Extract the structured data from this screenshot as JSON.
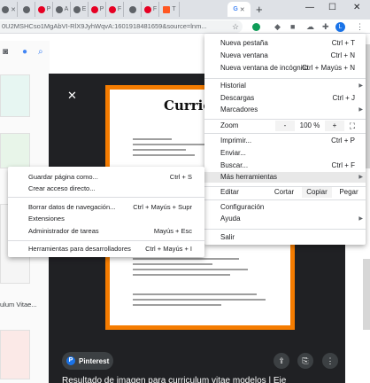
{
  "tabs": [
    {
      "icon": "page-icon",
      "letter": ""
    },
    {
      "icon": "page-icon",
      "letter": ""
    },
    {
      "icon": "pinterest-icon",
      "letter": "P"
    },
    {
      "icon": "page-icon",
      "letter": "A"
    },
    {
      "icon": "page-icon",
      "letter": "E"
    },
    {
      "icon": "pinterest-icon",
      "letter": "P"
    },
    {
      "icon": "pinterest-icon",
      "letter": "F"
    },
    {
      "icon": "page-icon",
      "letter": ""
    },
    {
      "icon": "pinterest-icon",
      "letter": "F"
    },
    {
      "icon": "orange-t-icon",
      "letter": "T"
    },
    {
      "icon": "google-icon",
      "letter": "G"
    }
  ],
  "address_bar": {
    "url": "0U2MSHCso1MgAbVI-RlX9JyhWqvA:1601918481659&source=lnm..."
  },
  "avatar_letter": "L",
  "menu": {
    "items_top": [
      {
        "label": "Nueva pestaña",
        "shortcut": "Ctrl + T"
      },
      {
        "label": "Nueva ventana",
        "shortcut": "Ctrl + N"
      },
      {
        "label": "Nueva ventana de incógnito",
        "shortcut": "Ctrl + Mayús + N"
      }
    ],
    "items_mid": [
      {
        "label": "Historial",
        "shortcut": ""
      },
      {
        "label": "Descargas",
        "shortcut": "Ctrl + J"
      },
      {
        "label": "Marcadores",
        "shortcut": ""
      }
    ],
    "zoom": {
      "label": "Zoom",
      "minus": "-",
      "value": "100 %",
      "plus": "+"
    },
    "items_print": [
      {
        "label": "Imprimir...",
        "shortcut": "Ctrl + P"
      },
      {
        "label": "Enviar...",
        "shortcut": ""
      },
      {
        "label": "Buscar...",
        "shortcut": "Ctrl + F"
      },
      {
        "label": "Más herramientas",
        "shortcut": ""
      }
    ],
    "edit": {
      "label": "Editar",
      "cut": "Cortar",
      "copy": "Copiar",
      "paste": "Pegar"
    },
    "items_bottom": [
      {
        "label": "Configuración",
        "shortcut": ""
      },
      {
        "label": "Ayuda",
        "shortcut": ""
      }
    ],
    "exit": "Salir"
  },
  "submenu": {
    "items": [
      {
        "label": "Guardar página como...",
        "shortcut": "Ctrl + S"
      },
      {
        "label": "Crear acceso directo...",
        "shortcut": ""
      },
      {
        "label": "Borrar datos de navegación...",
        "shortcut": "Ctrl + Mayús + Supr"
      },
      {
        "label": "Extensiones",
        "shortcut": ""
      },
      {
        "label": "Administrador de tareas",
        "shortcut": "Mayús + Esc"
      },
      {
        "label": "Herramientas para desarrolladores",
        "shortcut": "Ctrl + Mayús + I"
      }
    ]
  },
  "viewer": {
    "cv_title": "Curriculu",
    "source_badge": "Pinterest",
    "caption": "Resultado de imagen para curriculum vitae modelos | Eje"
  },
  "side": {
    "snippet": "ulum Vitae..."
  }
}
